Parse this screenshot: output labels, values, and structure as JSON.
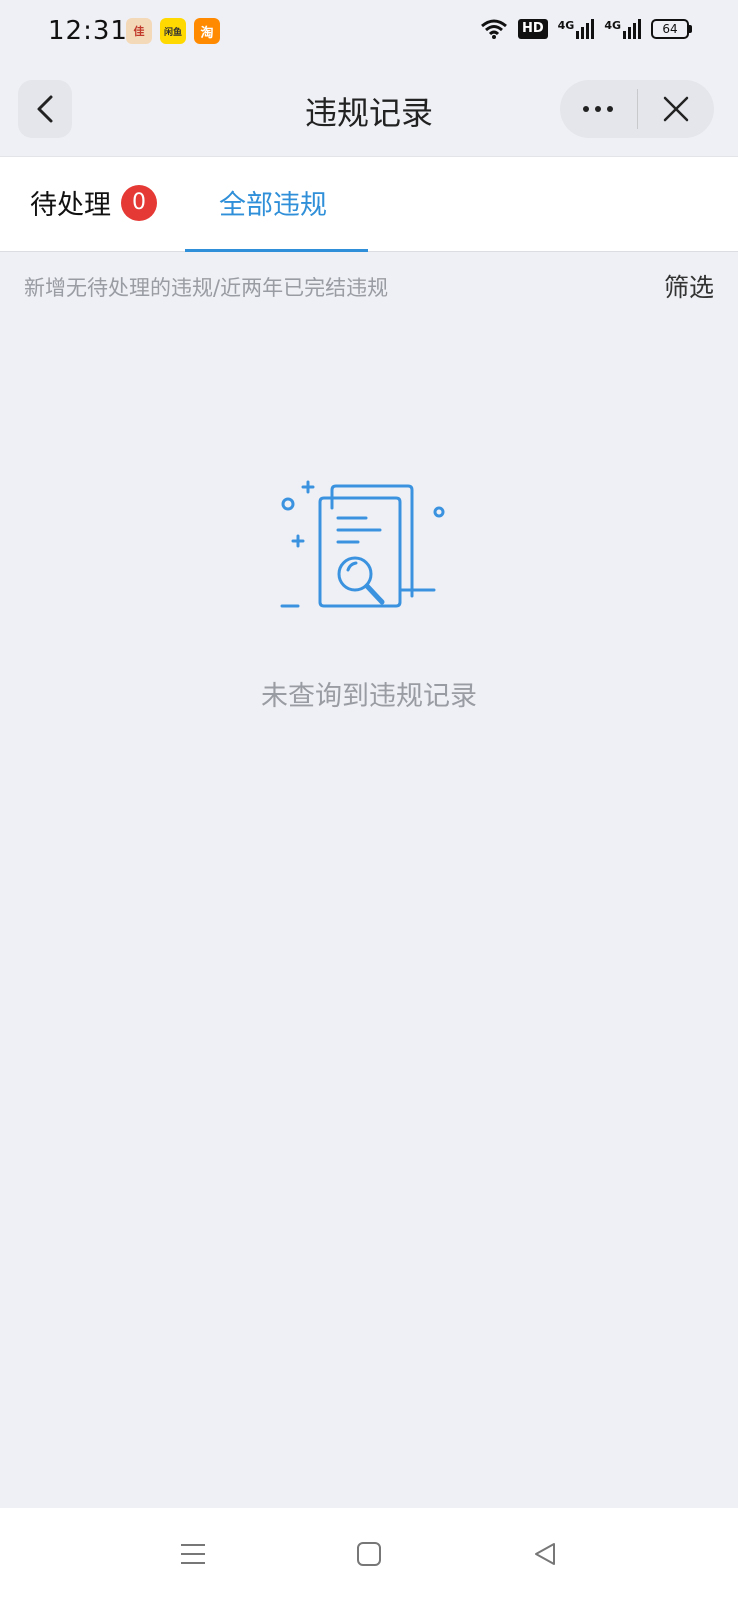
{
  "status_bar": {
    "time": "12:31",
    "app_icons": [
      "佳",
      "闲鱼",
      "淘"
    ],
    "network": [
      "4G",
      "4G"
    ],
    "hd_label": "HD",
    "battery": "64"
  },
  "navbar": {
    "title": "违规记录",
    "icons": [
      "back-icon",
      "more-icon",
      "close-icon"
    ]
  },
  "tabs": [
    {
      "label": "待处理",
      "badge": "0"
    },
    {
      "label": "全部违规",
      "active": true
    }
  ],
  "hint": {
    "text": "新增无待处理的违规/近两年已完结违规",
    "filter_label": "筛选"
  },
  "empty_state": {
    "text": "未查询到违规记录",
    "icon": "document-search-icon"
  },
  "colors": {
    "accent": "#2f8fd8",
    "badge": "#e53935",
    "background": "#eef0f5"
  },
  "system_nav": [
    "menu-icon",
    "home-icon",
    "back-triangle-icon"
  ]
}
